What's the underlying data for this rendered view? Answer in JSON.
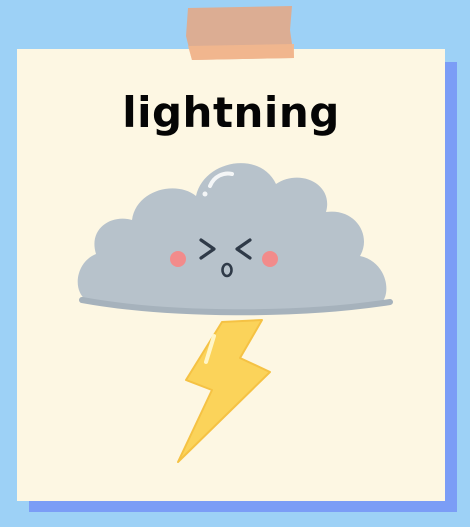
{
  "card": {
    "title": "lightning"
  },
  "colors": {
    "background": "#9dd1f6",
    "card": "#fdf7e3",
    "card_shadow": "#7b9df6",
    "tape": "#e2a98a",
    "cloud": "#b7c2cb",
    "bolt": "#fbd35a",
    "cheeks": "#f28b8b"
  },
  "illustration": {
    "subject": "cloud-with-lightning-bolt",
    "face": "squinting-face"
  }
}
